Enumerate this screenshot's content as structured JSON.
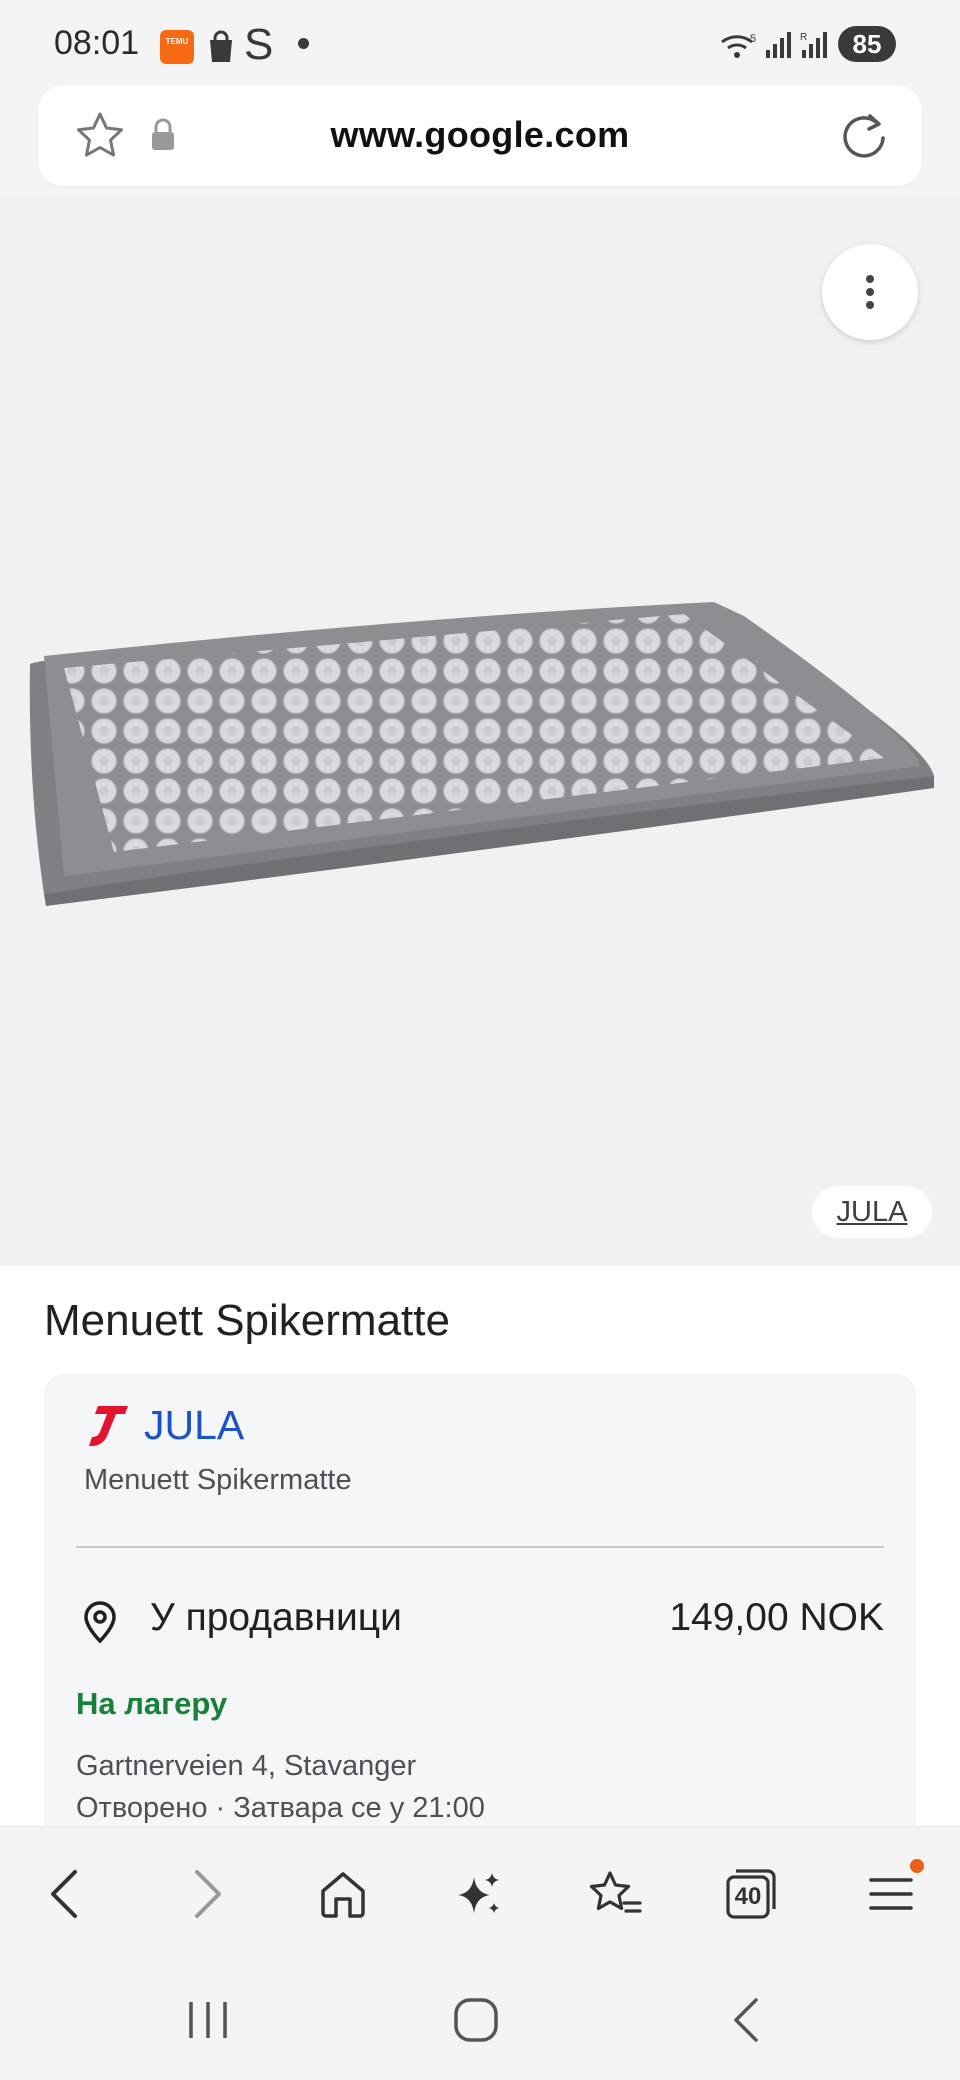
{
  "status_bar": {
    "time": "08:01",
    "battery": "85",
    "temu_badge": "TEMU",
    "s_letter": "S"
  },
  "url_bar": {
    "url": "www.google.com"
  },
  "image": {
    "source_label": "JULA",
    "background": "#f1f1f1"
  },
  "product": {
    "title": "Menuett Spikermatte"
  },
  "offer": {
    "merchant_name": "JULA",
    "merchant_product": "Menuett Spikermatte",
    "availability_label": "У продавници",
    "price": "149,00 NOK",
    "stock_status": "На лагеру",
    "address": "Gartnerveien 4, Stavanger",
    "hours": "Отворено · Затвара се у 21:00",
    "colors": {
      "merchant": "#1a53c9",
      "stock": "#188038"
    }
  },
  "toolbar": {
    "tabs_count": "40",
    "items": [
      "back-icon",
      "forward-icon",
      "home-icon",
      "ai-sparkle-icon",
      "bookmarks-icon",
      "tabs-icon",
      "menu-icon"
    ]
  },
  "navbar": {
    "items": [
      "recent-apps-icon",
      "home-circle-icon",
      "nav-back-icon"
    ]
  }
}
